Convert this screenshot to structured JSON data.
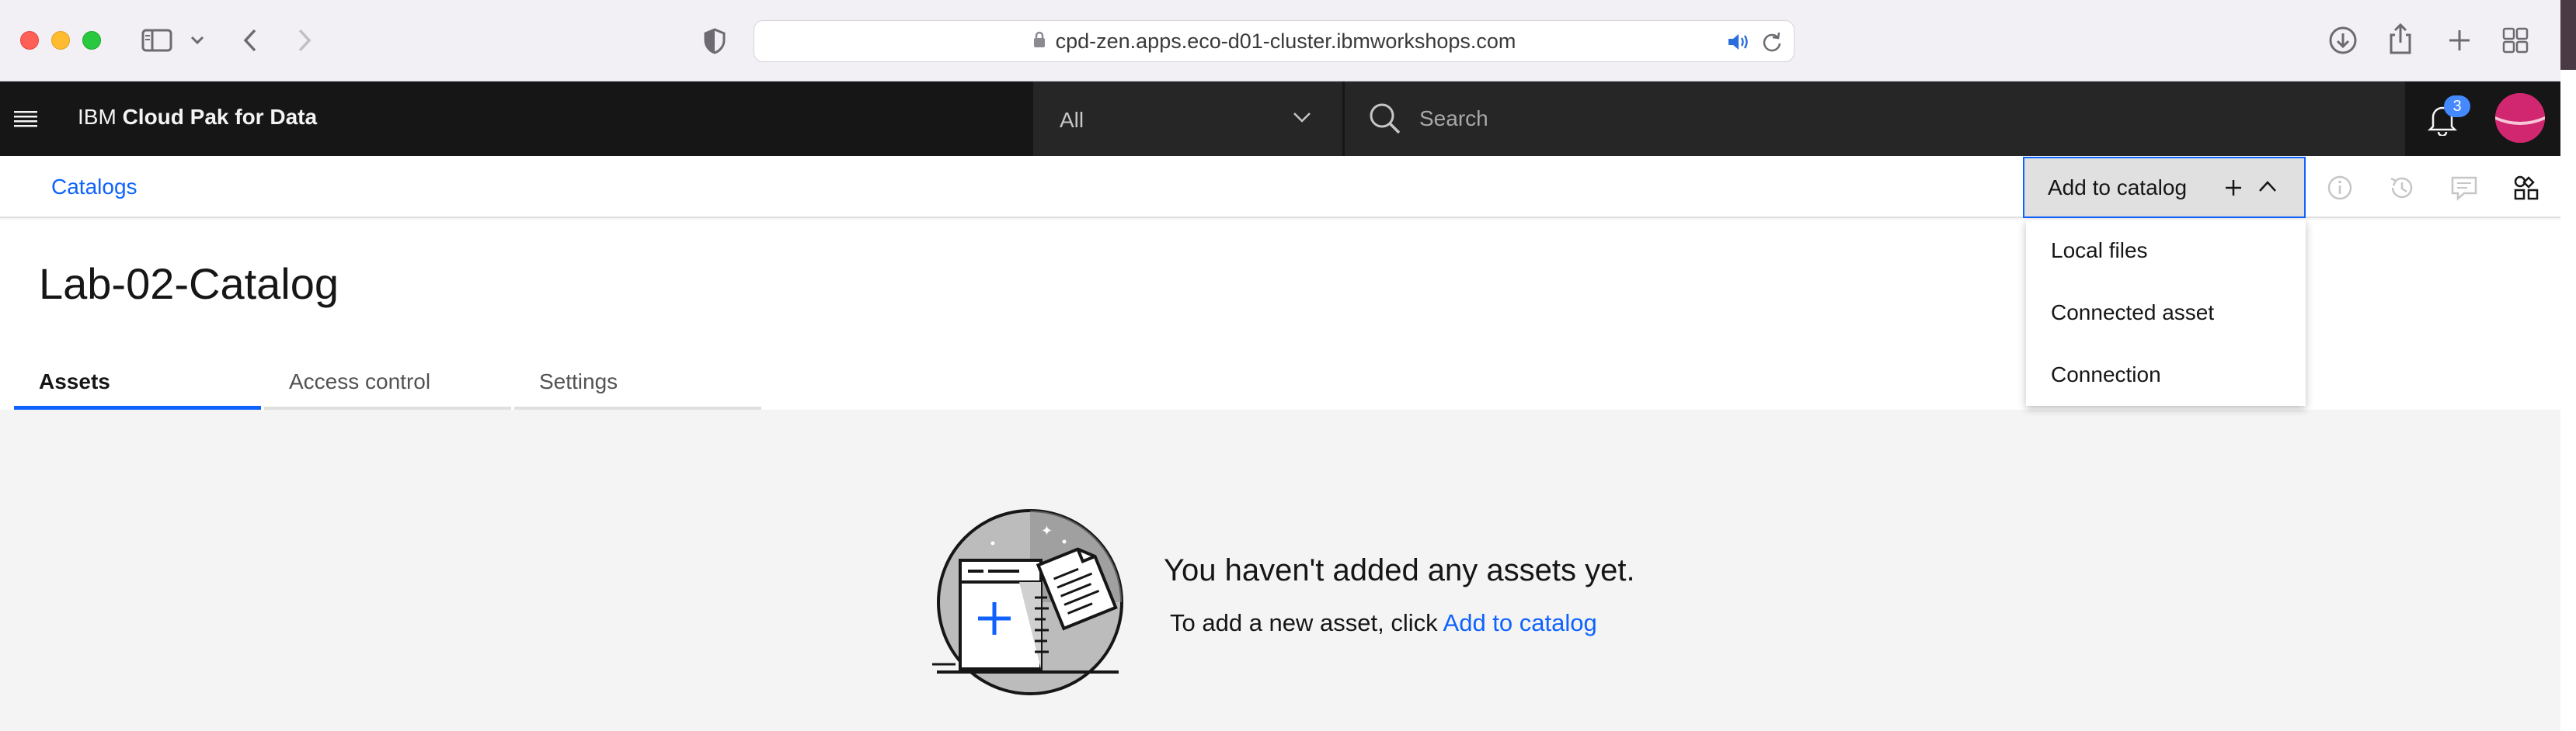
{
  "browser": {
    "url": "cpd-zen.apps.eco-d01-cluster.ibmworkshops.com"
  },
  "topnav": {
    "brand_prefix": "IBM",
    "brand_name": "Cloud Pak for Data",
    "scope_selected": "All",
    "search_placeholder": "Search",
    "notification_count": "3"
  },
  "breadcrumb": {
    "items": [
      "Catalogs"
    ]
  },
  "toolbar": {
    "add_to_catalog_label": "Add to catalog"
  },
  "add_menu": {
    "items": [
      "Local files",
      "Connected asset",
      "Connection"
    ]
  },
  "page": {
    "title": "Lab-02-Catalog",
    "tabs": [
      {
        "label": "Assets",
        "active": true
      },
      {
        "label": "Access control",
        "active": false
      },
      {
        "label": "Settings",
        "active": false
      }
    ]
  },
  "empty_state": {
    "title": "You haven't added any assets yet.",
    "description_prefix": "To add a new asset, click ",
    "description_link": "Add to catalog"
  },
  "colors": {
    "accent": "#0f62fe",
    "nav_bg": "#161616",
    "avatar": "#d12771"
  }
}
